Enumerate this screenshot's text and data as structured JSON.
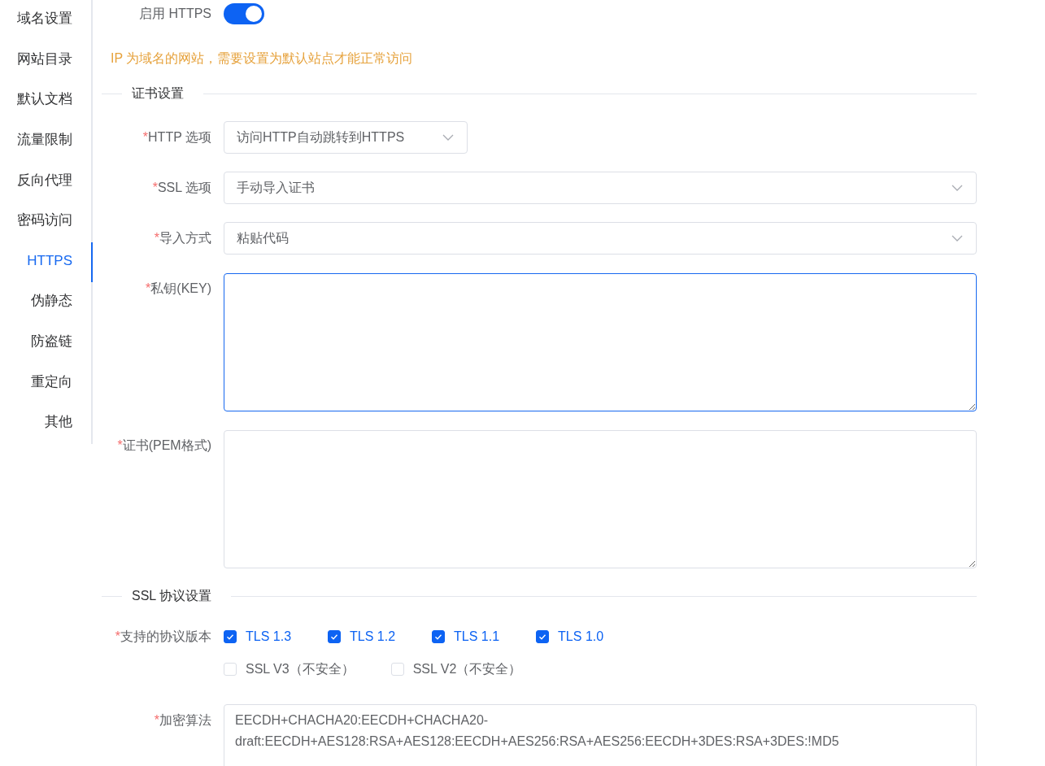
{
  "sidebar": {
    "items": [
      {
        "label": "域名设置",
        "selected": false
      },
      {
        "label": "网站目录",
        "selected": false
      },
      {
        "label": "默认文档",
        "selected": false
      },
      {
        "label": "流量限制",
        "selected": false
      },
      {
        "label": "反向代理",
        "selected": false
      },
      {
        "label": "密码访问",
        "selected": false
      },
      {
        "label": "HTTPS",
        "selected": true
      },
      {
        "label": "伪静态",
        "selected": false
      },
      {
        "label": "防盗链",
        "selected": false
      },
      {
        "label": "重定向",
        "selected": false
      },
      {
        "label": "其他",
        "selected": false
      }
    ]
  },
  "https_toggle": {
    "label": "启用 HTTPS",
    "on": true
  },
  "notice": "IP 为域名的网站，需要设置为默认站点才能正常访问",
  "certificate_section": {
    "title": "证书设置",
    "fields": [
      {
        "kind": "select",
        "label": "HTTP 选项",
        "required_mark": "*",
        "value": "访问HTTP自动跳转到HTTPS",
        "wide": false
      },
      {
        "kind": "select",
        "label": "SSL 选项",
        "required_mark": "*",
        "value": "手动导入证书",
        "wide": true
      },
      {
        "kind": "select",
        "label": "导入方式",
        "required_mark": "*",
        "value": "粘贴代码",
        "wide": true
      },
      {
        "kind": "textarea",
        "label": "私钥(KEY)",
        "required_mark": "*",
        "focused": true
      },
      {
        "kind": "textarea",
        "label": "证书(PEM格式)",
        "required_mark": "*",
        "focused": false
      }
    ]
  },
  "ssl_section": {
    "title": "SSL 协议设置",
    "protocol_versions": {
      "label": "支持的协议版本",
      "required_mark": "*",
      "rows": [
        {
          "options": [
            {
              "label": "TLS 1.3",
              "checked": true
            },
            {
              "label": "TLS 1.2",
              "checked": true
            },
            {
              "label": "TLS 1.1",
              "checked": true
            },
            {
              "label": "TLS 1.0",
              "checked": true
            }
          ]
        },
        {
          "options": [
            {
              "label": "SSL V3（不安全）",
              "checked": false
            },
            {
              "label": "SSL V2（不安全）",
              "checked": false
            }
          ]
        }
      ]
    },
    "cipher": {
      "label": "加密算法",
      "required_mark": "*",
      "value": "EECDH+CHACHA20:EECDH+CHACHA20-draft:EECDH+AES128:RSA+AES128:EECDH+AES256:RSA+AES256:EECDH+3DES:RSA+3DES:!MD5"
    }
  }
}
